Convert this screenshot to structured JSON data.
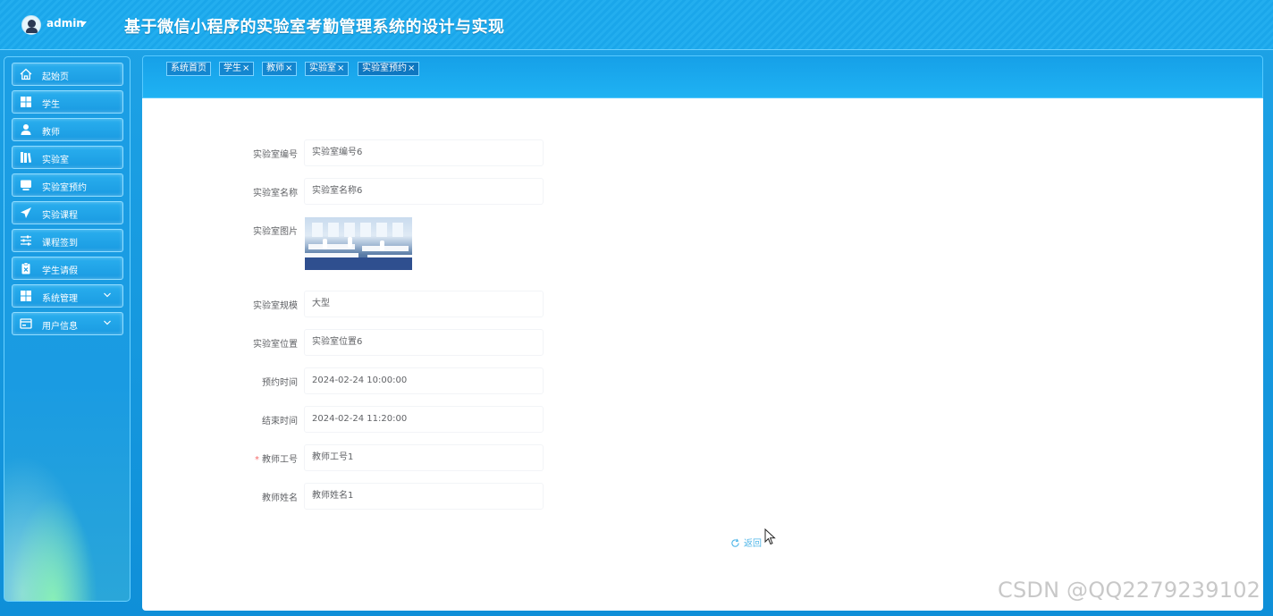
{
  "header": {
    "username": "admin",
    "app_title": "基于微信小程序的实验室考勤管理系统的设计与实现"
  },
  "sidebar": {
    "items": [
      {
        "label": "起始页",
        "icon": "home-icon"
      },
      {
        "label": "学生",
        "icon": "grid-icon"
      },
      {
        "label": "教师",
        "icon": "user-icon"
      },
      {
        "label": "实验室",
        "icon": "books-icon"
      },
      {
        "label": "实验室预约",
        "icon": "monitor-icon"
      },
      {
        "label": "实验课程",
        "icon": "paper-plane-icon"
      },
      {
        "label": "课程签到",
        "icon": "sliders-icon"
      },
      {
        "label": "学生请假",
        "icon": "clipboard-icon"
      },
      {
        "label": "系统管理",
        "icon": "grid-icon"
      },
      {
        "label": "用户信息",
        "icon": "card-icon"
      }
    ]
  },
  "tabs": [
    {
      "label": "系统首页",
      "closable": false
    },
    {
      "label": "学生",
      "closable": true
    },
    {
      "label": "教师",
      "closable": true
    },
    {
      "label": "实验室",
      "closable": true
    },
    {
      "label": "实验室预约",
      "closable": true
    }
  ],
  "tab_close_glyph": "×",
  "form": {
    "fields": [
      {
        "label": "实验室编号",
        "value": "实验室编号6"
      },
      {
        "label": "实验室名称",
        "value": "实验室名称6"
      },
      {
        "label": "实验室图片",
        "value": ""
      },
      {
        "label": "实验室规模",
        "value": "大型"
      },
      {
        "label": "实验室位置",
        "value": "实验室位置6"
      },
      {
        "label": "预约时间",
        "value": "2024-02-24 10:00:00"
      },
      {
        "label": "结束时间",
        "value": "2024-02-24 11:20:00"
      },
      {
        "label": "教师工号",
        "value": "教师工号1",
        "required": true
      },
      {
        "label": "教师姓名",
        "value": "教师姓名1"
      }
    ],
    "required_mark": "*",
    "back_label": "返回"
  },
  "watermark": "CSDN @QQ2279239102",
  "colors": {
    "header_bg": "#1aa6ea",
    "accent": "#52b7e8",
    "required": "#f56c6c"
  }
}
